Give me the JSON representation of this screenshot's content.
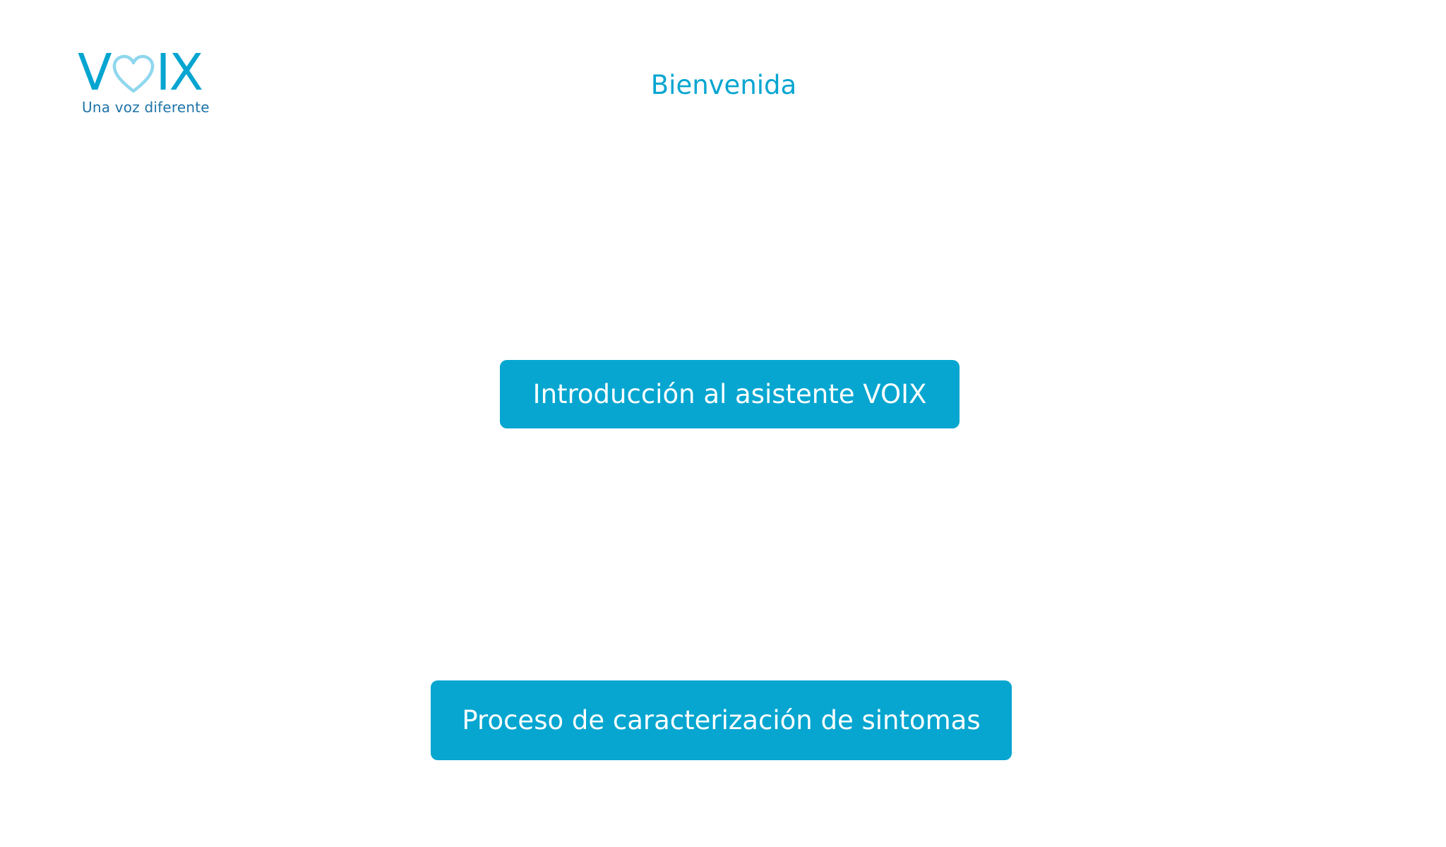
{
  "logo": {
    "letter_v": "V",
    "letters_ix": "IX",
    "tagline": "Una voz diferente",
    "icon": "heart-icon",
    "colors": {
      "letters": "#06a5d1",
      "heart_outline": "#8fd7ee",
      "tagline": "#1e74a8"
    }
  },
  "header": {
    "title": "Bienvenida"
  },
  "actions": {
    "intro_label": "Introducción al asistente VOIX",
    "process_label": "Proceso de caracterización de sintomas"
  },
  "theme": {
    "accent": "#06a6d0",
    "button_text": "#ffffff",
    "background": "#ffffff"
  }
}
